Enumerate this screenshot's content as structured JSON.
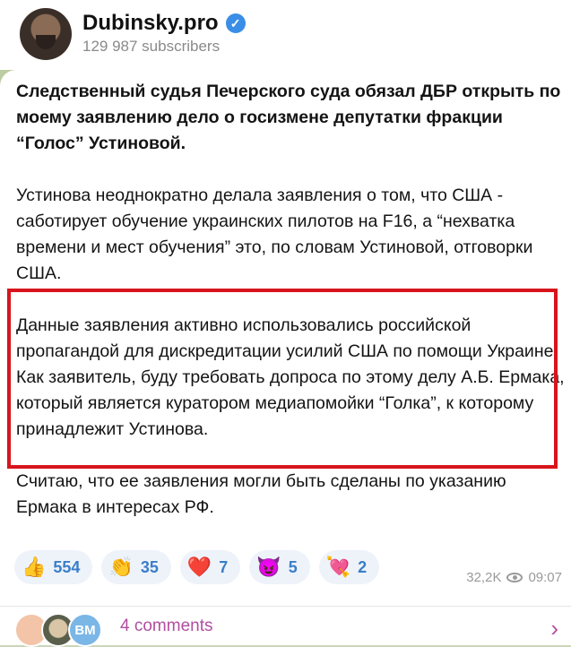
{
  "channel": {
    "name": "Dubinsky.pro",
    "subscribers": "129 987 subscribers"
  },
  "post": {
    "headline": "Следственный судья Печерского суда обязал ДБР открыть по моему заявлению дело о госизмене депутатки фракции “Голос” Устиновой.",
    "paragraph1": "Устинова неоднократно делала заявления о том, что США - саботирует обучение украинских пилотов на F16, а “нехватка времени и мест обучения” это, по словам Устиновой, отговорки США.",
    "paragraph2": "Данные заявления активно использовались российской пропагандой для дискредитации усилий США по помощи Украине. Как заявитель, буду требовать допроса по этому делу А.Б. Ермака, который является куратором медиапомойки “Голка”, к которому принадлежит Устинова.",
    "paragraph3": "Считаю, что ее заявления могли быть сделаны по указанию Ермака в интересах РФ."
  },
  "reactions": [
    {
      "emoji": "👍",
      "count": "554",
      "icon": "thumbs-up-icon"
    },
    {
      "emoji": "👏",
      "count": "35",
      "icon": "clapping-hands-icon"
    },
    {
      "emoji": "❤️",
      "count": "7",
      "icon": "red-heart-icon"
    },
    {
      "emoji": "😈",
      "count": "5",
      "icon": "smiling-devil-icon"
    },
    {
      "emoji": "💘",
      "count": "2",
      "icon": "heart-with-arrow-icon"
    }
  ],
  "meta": {
    "views": "32,2K",
    "time": "09:07"
  },
  "comments": {
    "label": "4 comments",
    "avatar3_initials": "BM"
  },
  "colors": {
    "highlight_border": "#d8141c",
    "accent_link": "#b24ea0",
    "reaction_text": "#3a7ec8",
    "verified_badge": "#3a8ee6"
  }
}
